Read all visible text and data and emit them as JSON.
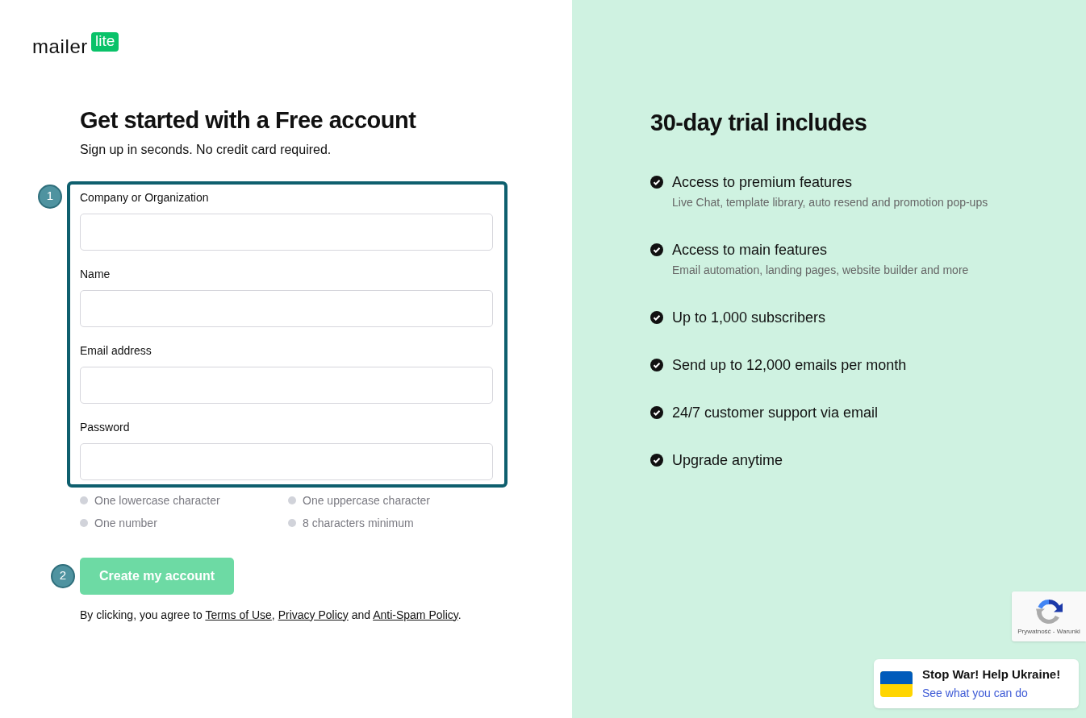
{
  "logo": {
    "word": "mailer",
    "badge": "lite"
  },
  "form": {
    "title": "Get started with a Free account",
    "subtitle": "Sign up in seconds. No credit card required.",
    "step_markers": [
      "1",
      "2"
    ],
    "fields": [
      {
        "label": "Company or Organization"
      },
      {
        "label": "Name"
      },
      {
        "label": "Email address"
      },
      {
        "label": "Password"
      }
    ],
    "password_rules": [
      {
        "text": "One lowercase character",
        "met": false
      },
      {
        "text": "One uppercase character",
        "met": false
      },
      {
        "text": "One number",
        "met": false
      },
      {
        "text": "8 characters minimum",
        "met": false
      }
    ],
    "submit": {
      "label": "Create my account",
      "disabled": true
    },
    "agreement": {
      "before": "By clicking, you agree to ",
      "links": [
        "Terms of Use",
        "Privacy Policy",
        "Anti-Spam Policy"
      ],
      "after": [
        ", ",
        " and ",
        "."
      ]
    }
  },
  "trial": {
    "title": "30-day trial includes",
    "items": [
      {
        "title": "Access to premium features",
        "detail": "Live Chat, template library, auto resend and promotion pop-ups"
      },
      {
        "title": "Access to main features",
        "detail": "Email automation, landing pages, website builder and more"
      },
      {
        "title": "Up to 1,000 subscribers"
      },
      {
        "title": "Send up to 12,000 emails per month"
      },
      {
        "title": "24/7 customer support via email"
      },
      {
        "title": "Upgrade anytime"
      }
    ]
  },
  "recaptcha": {
    "links": "Prywatność - Warunki"
  },
  "ukraine_banner": {
    "title": "Stop War! Help Ukraine!",
    "link": "See what you can do"
  }
}
